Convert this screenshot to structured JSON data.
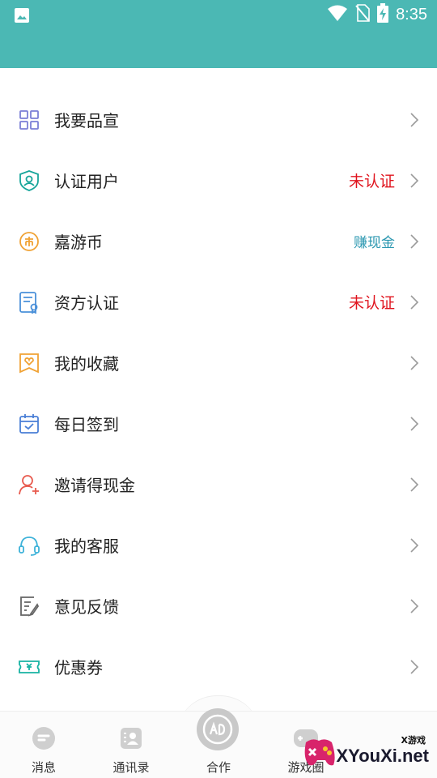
{
  "status_bar": {
    "time": "8:35",
    "background": "#4bb8b4",
    "left_icon": "image-icon",
    "right_icons": [
      "wifi-icon",
      "no-sim-icon",
      "battery-charging-icon"
    ]
  },
  "menu": {
    "items": [
      {
        "label": "我要品宣",
        "icon": "grid-icon",
        "extra": ""
      },
      {
        "label": "认证用户",
        "icon": "shield-icon",
        "extra": "未认证"
      },
      {
        "label": "嘉游币",
        "icon": "coin-icon",
        "extra": "赚现金"
      },
      {
        "label": "资方认证",
        "icon": "certificate-icon",
        "extra": "未认证"
      },
      {
        "label": "我的收藏",
        "icon": "favorite-heart-icon",
        "extra": ""
      },
      {
        "label": "每日签到",
        "icon": "calendar-check-icon",
        "extra": ""
      },
      {
        "label": "邀请得现金",
        "icon": "user-add-icon",
        "extra": ""
      },
      {
        "label": "我的客服",
        "icon": "headset-icon",
        "extra": ""
      },
      {
        "label": "意见反馈",
        "icon": "feedback-edit-icon",
        "extra": ""
      },
      {
        "label": "优惠券",
        "icon": "coupon-icon",
        "extra": ""
      }
    ],
    "colors": {
      "red_status": "#e0141e",
      "teal_link": "#2b97b0"
    }
  },
  "tabbar": {
    "tabs": [
      {
        "label": "消息",
        "icon": "message-icon"
      },
      {
        "label": "通讯录",
        "icon": "contacts-icon"
      },
      {
        "label": "合作",
        "icon": "cooperation-icon"
      },
      {
        "label": "游戏圈",
        "icon": "game-circle-icon"
      }
    ]
  },
  "watermark": {
    "small": "X游戏",
    "big": "XYouXi.net"
  }
}
